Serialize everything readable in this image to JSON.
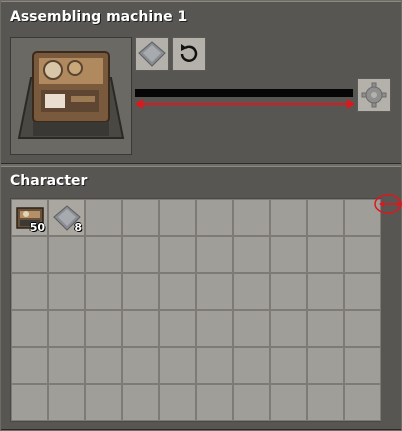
{
  "machine_panel": {
    "title": "Assembling machine 1",
    "icons": {
      "machine": "assembling-machine-icon",
      "recipe": "iron-plate-icon",
      "change_recipe": "refresh-icon",
      "output": "gear-icon"
    },
    "progress": 0.0
  },
  "character_panel": {
    "title": "Character",
    "inventory": [
      {
        "icon": "assembling-machine-icon",
        "count": "50"
      },
      {
        "icon": "iron-plate-icon",
        "count": "8"
      }
    ]
  },
  "colors": {
    "annotation": "#e0161d",
    "panel": "#585652",
    "slot": "#a09e98"
  }
}
